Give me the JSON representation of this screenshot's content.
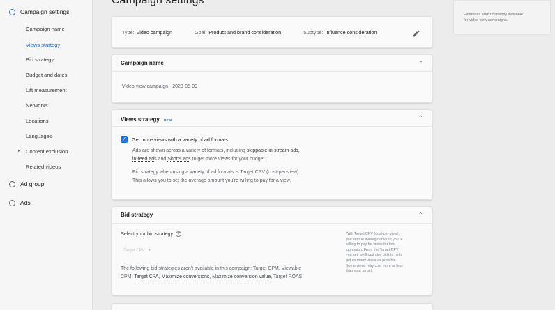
{
  "sidebar": {
    "campaign_settings": "Campaign settings",
    "items": [
      {
        "label": "Campaign name"
      },
      {
        "label": "Views strategy"
      },
      {
        "label": "Bid strategy"
      },
      {
        "label": "Budget and dates"
      },
      {
        "label": "Lift measurement"
      },
      {
        "label": "Networks"
      },
      {
        "label": "Locations"
      },
      {
        "label": "Languages"
      },
      {
        "label": "Content exclusion"
      },
      {
        "label": "Related videos"
      }
    ],
    "ad_group": "Ad group",
    "ads": "Ads"
  },
  "page_title": "Campaign settings",
  "summary": {
    "type_label": "Type:",
    "type_value": "Video campaign",
    "goal_label": "Goal:",
    "goal_value": "Product and brand consideration",
    "subtype_label": "Subtype:",
    "subtype_value": "Influence consideration"
  },
  "campaign_name": {
    "title": "Campaign name",
    "value": "Video view campaign - 2023-05-09"
  },
  "views_strategy": {
    "title": "Views strategy",
    "badge": "NEW",
    "checkbox_label": "Get more views with a variety of ad formats",
    "desc_1": "Ads are shown across a variety of formats, including",
    "link_skippable": "skippable in-stream ads",
    "comma": ",",
    "link_infeed": "in-feed ads",
    "and": " and ",
    "link_shorts": "Shorts ads",
    "desc_2": " to get more views for your budget.",
    "bid_line_1": "Bid strategy when using a variety of ad formats is Target CPV (cost-per-view).",
    "bid_line_2": "This allows you to set the average amount you're willing to pay for a view."
  },
  "bid_strategy": {
    "title": "Bid strategy",
    "select_label": "Select your bid strategy",
    "dropdown_value": "Target CPV",
    "unavailable_1": "The following bid strategies aren't available in this campaign: Target CPM, Viewable",
    "unavailable_2_a": "CPM, ",
    "link_tcpa": "Target CPA",
    "sep1": ", ",
    "link_maxconv": "Maximize conversions",
    "sep2": ", ",
    "link_maxval": "Maximize conversion value",
    "sep3": ", Target ROAS",
    "help_lines": [
      "With Target CPV (cost-per-view),",
      "you set the average amount you're",
      "willing to pay for views for this",
      "campaign. From the Target CPV",
      "you set, we'll optimize bids to help",
      "get as many views as possible.",
      "Some views may cost more or less",
      "than your target."
    ]
  },
  "side_note": {
    "line_1": "Estimates aren't currently available",
    "line_2": "for video view campaigns."
  },
  "colors": {
    "accent": "#1a73e8",
    "background": "#ececec",
    "card": "#fafafa"
  }
}
